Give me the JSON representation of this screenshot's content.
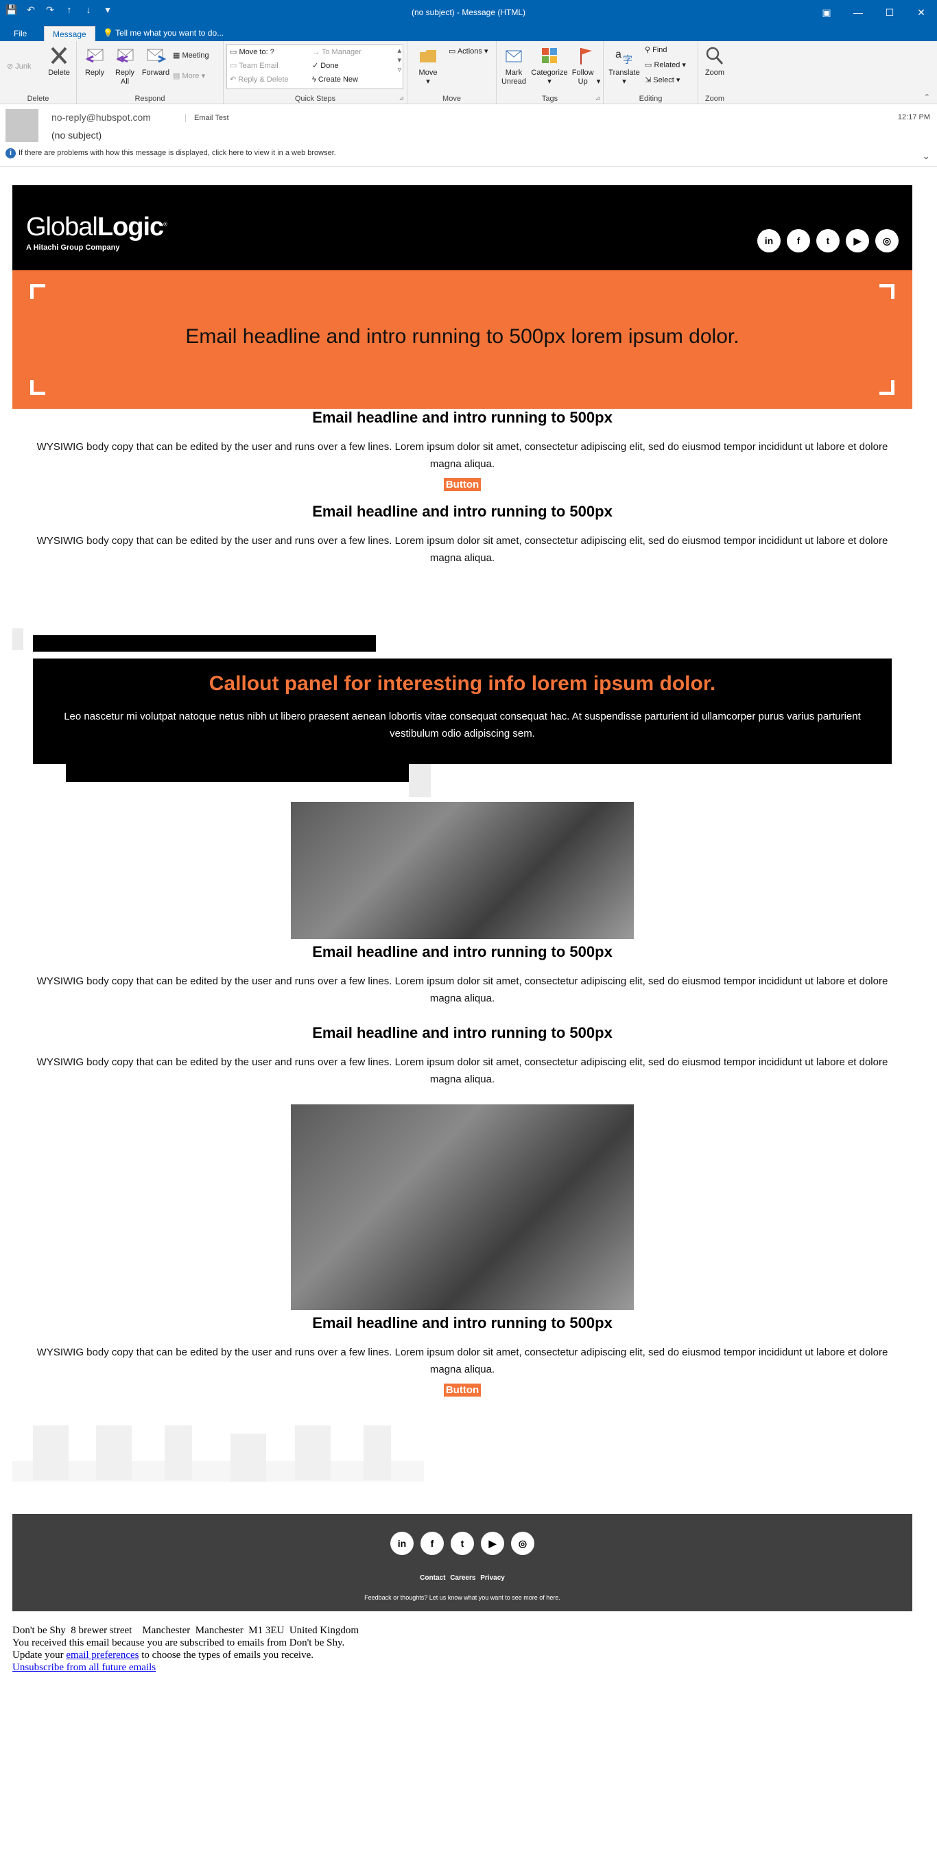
{
  "window": {
    "title": "(no subject)  -  Message (HTML)"
  },
  "tabs": {
    "file": "File",
    "message": "Message",
    "tell_me": "Tell me what you want to do..."
  },
  "ribbon": {
    "delete_group": {
      "label": "Delete",
      "junk": "Junk",
      "delete": "Delete"
    },
    "respond_group": {
      "label": "Respond",
      "reply": "Reply",
      "reply_all": "Reply All",
      "forward": "Forward",
      "meeting": "Meeting",
      "more": "More"
    },
    "quick_steps_group": {
      "label": "Quick Steps",
      "move_to": "Move to: ?",
      "team_email": "Team Email",
      "reply_delete": "Reply & Delete",
      "to_manager": "To Manager",
      "done": "Done",
      "create_new": "Create New"
    },
    "move_group": {
      "label": "Move",
      "move": "Move",
      "actions": "Actions"
    },
    "tags_group": {
      "label": "Tags",
      "mark_unread": "Mark Unread",
      "categorize": "Categorize",
      "follow_up": "Follow Up"
    },
    "editing_group": {
      "label": "Editing",
      "translate": "Translate",
      "find": "Find",
      "related": "Related",
      "select": "Select"
    },
    "zoom_group": {
      "label": "Zoom",
      "zoom": "Zoom"
    }
  },
  "message_header": {
    "sender": "no-reply@hubspot.com",
    "to": "Email Test",
    "subject": "(no subject)",
    "time": "12:17 PM",
    "info": "If there are problems with how this message is displayed, click here to view it in a web browser."
  },
  "email": {
    "logo_text_light": "Global",
    "logo_text_bold": "Logic",
    "logo_sub": "A Hitachi Group Company",
    "social": [
      "in",
      "f",
      "t",
      "▶",
      "◎"
    ],
    "hero_headline": "Email headline and intro running to 500px lorem ipsum dolor.",
    "sections": [
      {
        "heading": "Email headline and intro running to 500px",
        "body": "WYSIWIG body copy that can be edited by the user and runs over a few lines. Lorem ipsum dolor sit amet, consectetur adipiscing elit, sed do eiusmod tempor incididunt ut labore et dolore magna aliqua."
      },
      {
        "heading": "Email headline and intro running to 500px",
        "body": "WYSIWIG body copy that can be edited by the user and runs over a few lines. Lorem ipsum dolor sit amet, consectetur adipiscing elit, sed do eiusmod tempor incididunt ut labore et dolore magna aliqua."
      },
      {
        "heading": "Email headline and intro running to 500px",
        "body": "WYSIWIG body copy that can be edited by the user and runs over a few lines. Lorem ipsum dolor sit amet, consectetur adipiscing elit, sed do eiusmod tempor incididunt ut labore et dolore magna aliqua."
      },
      {
        "heading": "Email headline and intro running to 500px",
        "body": "WYSIWIG body copy that can be edited by the user and runs over a few lines. Lorem ipsum dolor sit amet, consectetur adipiscing elit, sed do eiusmod tempor incididunt ut labore et dolore magna aliqua."
      },
      {
        "heading": "Email headline and intro running to 500px",
        "body": "WYSIWIG body copy that can be edited by the user and runs over a few lines. Lorem ipsum dolor sit amet, consectetur adipiscing elit, sed do eiusmod tempor incididunt ut labore et dolore magna aliqua."
      }
    ],
    "button_label": "Button",
    "callout_title": "Callout panel for interesting info lorem ipsum dolor.",
    "callout_body": "Leo nascetur mi volutpat natoque netus nibh ut libero praesent aenean lobortis vitae consequat consequat hac. At suspendisse parturient id ullamcorper purus varius parturient vestibulum odio adipiscing sem.",
    "footer_links": [
      "Contact",
      "Careers",
      "Privacy"
    ],
    "footer_feedback": "Feedback or thoughts? Let us know what you want to see more of here."
  },
  "legal": {
    "address": "Don't be Shy  8 brewer street    Manchester  Manchester  M1 3EU  United Kingdom",
    "reason": "You received this email because you are subscribed to emails from Don't be Shy.",
    "update_prefix": "Update your",
    "preferences_link": "email preferences",
    "update_suffix": "to choose the types of emails you receive.",
    "unsubscribe": "Unsubscribe from all future emails"
  },
  "colors": {
    "accent": "#f37338",
    "title_bar": "#0063b1",
    "footer": "#404040"
  }
}
